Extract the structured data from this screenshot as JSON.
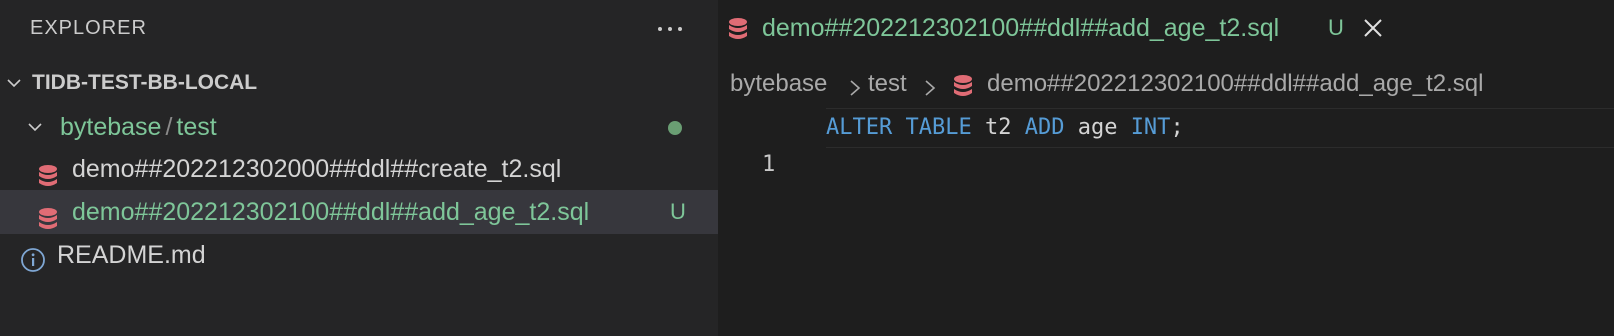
{
  "explorer": {
    "title": "EXPLORER",
    "more_icon": "ellipsis-icon",
    "root": {
      "label": "TIDB-TEST-BB-LOCAL",
      "icon": "chevron-down-icon"
    },
    "folder": {
      "part1": "bytebase",
      "separator": "/",
      "part2": "test",
      "icon": "chevron-down-icon"
    },
    "files": [
      {
        "name": "demo##202212302000##ddl##create_t2.sql",
        "icon": "database-icon",
        "badge": ""
      },
      {
        "name": "demo##202212302100##ddl##add_age_t2.sql",
        "icon": "database-icon",
        "badge": "U",
        "selected": true
      },
      {
        "name": "README.md",
        "icon": "info-icon",
        "badge": ""
      }
    ]
  },
  "editor": {
    "tab": {
      "label": "demo##202212302100##ddl##add_age_t2.sql",
      "badge": "U",
      "close_icon": "close-icon"
    },
    "breadcrumb": [
      "bytebase",
      "test",
      "demo##202212302100##ddl##add_age_t2.sql"
    ],
    "lines": [
      {
        "number": "1",
        "tokens": [
          "ALTER",
          " ",
          "TABLE",
          " t2 ",
          "ADD",
          " age ",
          "INT",
          ";"
        ]
      }
    ]
  },
  "colors": {
    "accent_green": "#7ec699",
    "db_icon": "#e06c75",
    "keyword": "#569cd6",
    "selection": "#37373d"
  }
}
